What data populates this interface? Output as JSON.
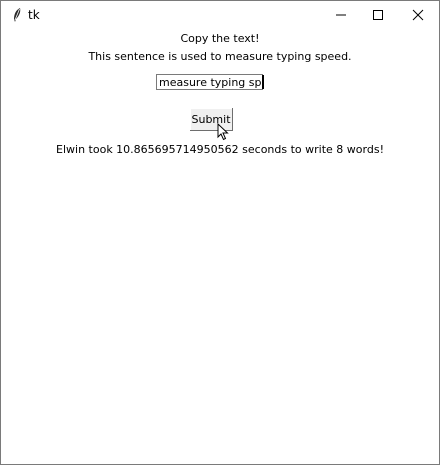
{
  "window": {
    "title": "tk",
    "icons": [
      "tk-feather-icon",
      "minimize-icon",
      "maximize-icon",
      "close-icon"
    ]
  },
  "content": {
    "prompt": "Copy the text!",
    "sentence": "This sentence is used to measure typing speed.",
    "entry_value": "measure typing speed",
    "submit_label": "Submit",
    "result": "Elwin took 10.865695714950562 seconds to write 8 words!"
  }
}
